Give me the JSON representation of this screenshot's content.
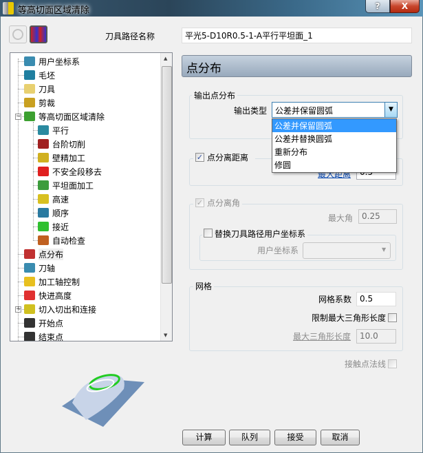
{
  "window": {
    "title": "等高切面区域清除",
    "help": "?",
    "close": "X"
  },
  "toolbar": {
    "name_label": "刀具路径名称",
    "name_value": "平光5-D10R0.5-1-A平行平坦面_1"
  },
  "tree": {
    "items": [
      {
        "label": "用户坐标系",
        "icon": "ucs-icon"
      },
      {
        "label": "毛坯",
        "icon": "block-icon"
      },
      {
        "label": "刀具",
        "icon": "tool-icon"
      },
      {
        "label": "剪裁",
        "icon": "trim-icon"
      },
      {
        "label": "等高切面区域清除",
        "icon": "area-clearance-icon"
      },
      {
        "label": "平行",
        "icon": "parallel-icon"
      },
      {
        "label": "台阶切削",
        "icon": "step-cut-icon"
      },
      {
        "label": "壁精加工",
        "icon": "wall-finish-icon"
      },
      {
        "label": "不安全段移去",
        "icon": "unsafe-segment-icon"
      },
      {
        "label": "平坦面加工",
        "icon": "flat-icon"
      },
      {
        "label": "高速",
        "icon": "high-speed-icon"
      },
      {
        "label": "顺序",
        "icon": "order-icon"
      },
      {
        "label": "接近",
        "icon": "approach-icon"
      },
      {
        "label": "自动检查",
        "icon": "auto-check-icon"
      },
      {
        "label": "点分布",
        "icon": "point-distribution-icon"
      },
      {
        "label": "刀轴",
        "icon": "tool-axis-icon"
      },
      {
        "label": "加工轴控制",
        "icon": "axis-control-icon"
      },
      {
        "label": "快进高度",
        "icon": "rapid-height-icon"
      },
      {
        "label": "切入切出和连接",
        "icon": "leads-links-icon"
      },
      {
        "label": "开始点",
        "icon": "start-point-icon"
      },
      {
        "label": "结束点",
        "icon": "end-point-icon"
      }
    ]
  },
  "panel": {
    "title": "点分布",
    "output": {
      "group": "输出点分布",
      "type_label": "输出类型",
      "type_value": "公差并保留圆弧",
      "options": [
        "公差并保留圆弧",
        "公差并替换圆弧",
        "重新分布",
        "修圆"
      ]
    },
    "distance": {
      "group": "点分离距离",
      "checked": true,
      "label": "最大距离",
      "value": "0.5"
    },
    "angle": {
      "group": "点分离角",
      "checked": true,
      "max_label": "最大角",
      "max_value": "0.25",
      "replace_label": "替换刀具路径用户坐标系",
      "replace_checked": false,
      "ucs_label": "用户坐标系",
      "ucs_value": ""
    },
    "mesh": {
      "group": "网格",
      "factor_label": "网格系数",
      "factor_value": "0.5",
      "limit_label": "限制最大三角形长度",
      "limit_checked": false,
      "max_len_label": "最大三角形长度",
      "max_len_value": "10.0"
    },
    "contact_label": "接触点法线",
    "contact_checked": false
  },
  "buttons": {
    "calculate": "计算",
    "queue": "队列",
    "accept": "接受",
    "cancel": "取消"
  }
}
